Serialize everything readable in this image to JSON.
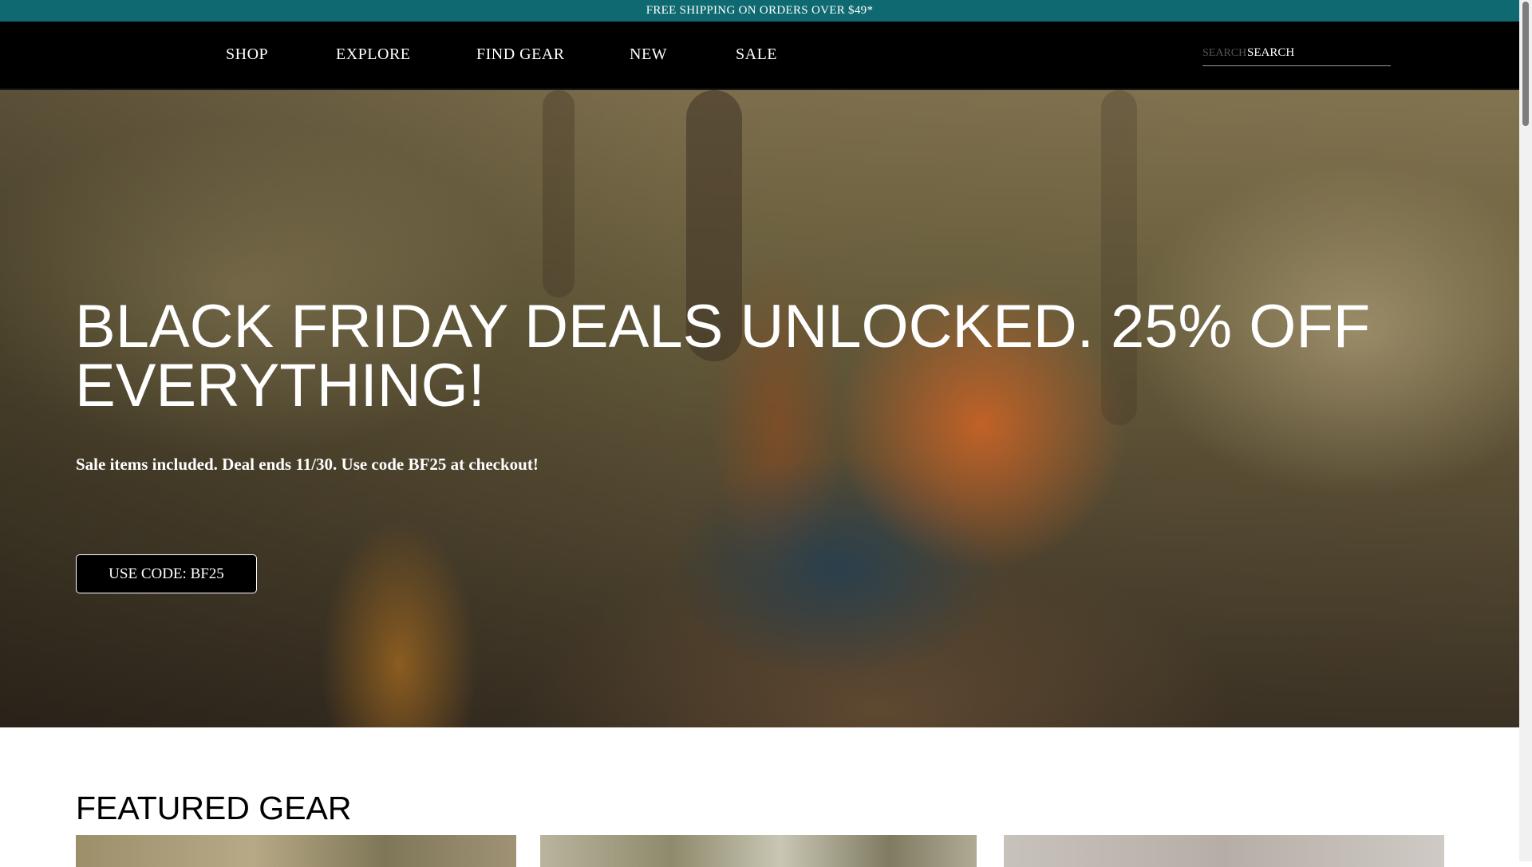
{
  "promo": {
    "text": "FREE SHIPPING ON ORDERS OVER $49*"
  },
  "nav": {
    "items": [
      {
        "label": "SHOP"
      },
      {
        "label": "EXPLORE"
      },
      {
        "label": "FIND GEAR"
      },
      {
        "label": "NEW"
      },
      {
        "label": "SALE"
      }
    ]
  },
  "search": {
    "label": "SEARCH",
    "placeholder": "SEARCH"
  },
  "hero": {
    "title": "BLACK FRIDAY DEALS UNLOCKED. 25% OFF EVERYTHING!",
    "subtitle": "Sale items included. Deal ends 11/30. Use code BF25 at checkout!",
    "button": "USE CODE: BF25"
  },
  "featured": {
    "title": "FEATURED GEAR"
  },
  "colors": {
    "promo_bg": "#0e6a70",
    "header_bg": "#000000"
  }
}
